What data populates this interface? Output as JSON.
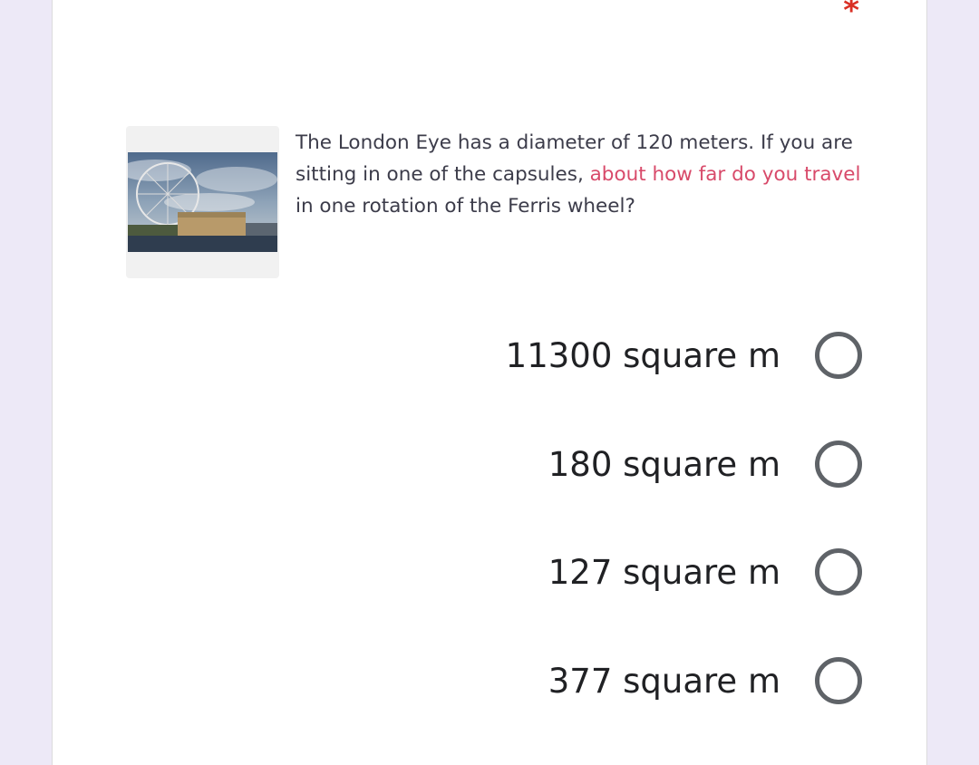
{
  "question": {
    "required_marker": "*",
    "text_part1": "The London Eye has a diameter of 120 meters. If you are sitting in one of the capsules, ",
    "text_highlight": "about how far do you travel",
    "text_part2": " in one rotation of the Ferris wheel?",
    "image_icon": "london-eye-photo"
  },
  "options": [
    {
      "label": "11300 square m",
      "selected": false
    },
    {
      "label": "180 square m",
      "selected": false
    },
    {
      "label": "127 square m",
      "selected": false
    },
    {
      "label": "377 square m",
      "selected": false
    }
  ],
  "colors": {
    "background": "#ede9f7",
    "card": "#ffffff",
    "required": "#d93025",
    "highlight": "#d84a6a",
    "radio_border": "#5f6368"
  }
}
